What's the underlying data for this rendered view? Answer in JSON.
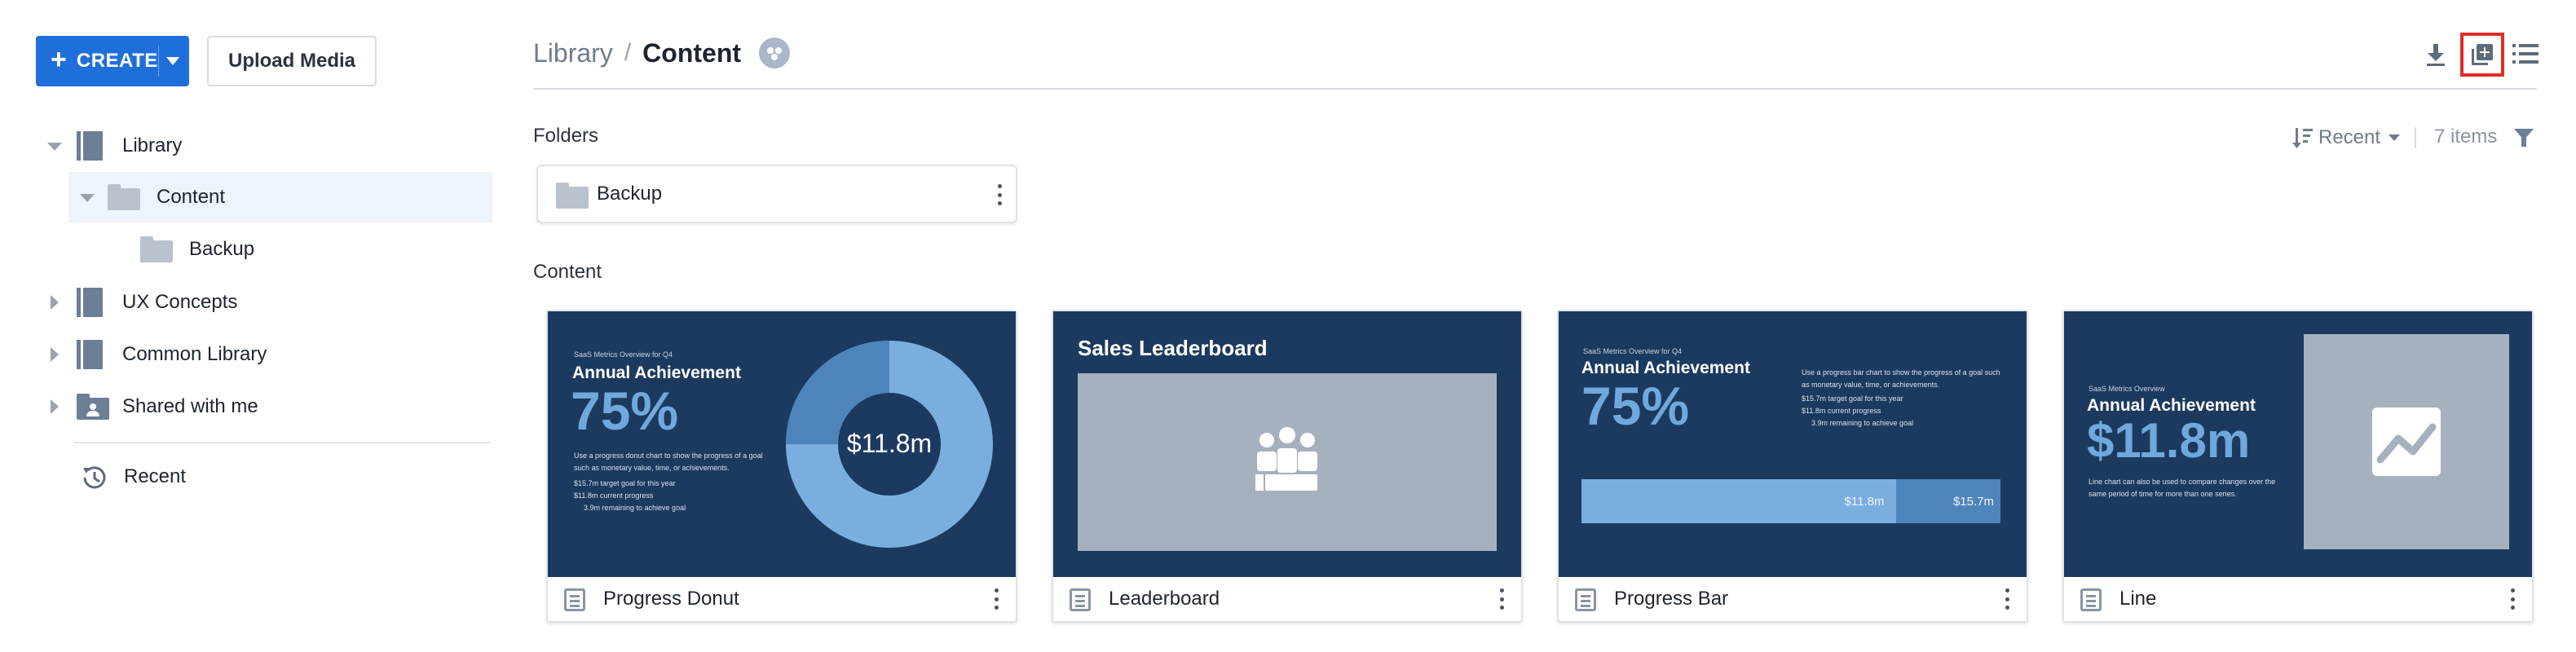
{
  "toolbar": {
    "create_label": "CREATE",
    "create_plus": "+",
    "upload_label": "Upload Media"
  },
  "sidebar": {
    "items": [
      {
        "label": "Library",
        "icon": "book-icon",
        "expanded": true
      },
      {
        "label": "Content",
        "icon": "folder-icon",
        "expanded": true,
        "selected": true
      },
      {
        "label": "Backup",
        "icon": "folder-icon"
      },
      {
        "label": "UX Concepts",
        "icon": "book-icon",
        "expanded": false
      },
      {
        "label": "Common Library",
        "icon": "book-icon",
        "expanded": false
      },
      {
        "label": "Shared with me",
        "icon": "shared-folder-icon",
        "expanded": false
      }
    ],
    "recent_label": "Recent"
  },
  "breadcrumb": {
    "root": "Library",
    "separator": "/",
    "current": "Content"
  },
  "header_tools": {
    "download": "download-icon",
    "add_view": "add-view-icon",
    "list_view": "list-view-icon",
    "highlight_color": "#e22d26"
  },
  "folders_section": {
    "label": "Folders",
    "sort_label": "Recent",
    "items_count": "7 items",
    "folders": [
      {
        "label": "Backup"
      }
    ]
  },
  "content_section": {
    "label": "Content",
    "cards": [
      {
        "title": "Progress Donut",
        "thumb": {
          "kicker": "SaaS Metrics Overview for Q4",
          "heading": "Annual Achievement",
          "big": "75%",
          "desc": "Use a progress donut chart to show the progress of a goal such as monetary value, time, or achievements.",
          "legend": [
            "$15.7m  target goal for this year",
            "$11.8m  current progress",
            "3.9m  remaining to achieve goal"
          ],
          "donut_label": "$11.8m",
          "donut_progress": 0.75
        }
      },
      {
        "title": "Leaderboard",
        "thumb": {
          "heading": "Sales Leaderboard"
        }
      },
      {
        "title": "Progress Bar",
        "thumb": {
          "kicker": "SaaS Metrics Overview for Q4",
          "heading": "Annual Achievement",
          "big": "75%",
          "desc": "Use a progress bar chart to show the progress of a goal such as monetary value, time, or achievements.",
          "legend": [
            "$15.7m  target goal for this year",
            "$11.8m  current progress",
            "3.9m  remaining to achieve goal"
          ],
          "bar_current": "$11.8m",
          "bar_target": "$15.7m",
          "bar_progress": 0.75
        }
      },
      {
        "title": "Line",
        "thumb": {
          "kicker": "SaaS Metrics Overview",
          "heading": "Annual Achievement",
          "big": "$11.8m",
          "desc": "Line chart can also be used to compare changes over the same period of time for more than one series."
        }
      }
    ]
  },
  "colors": {
    "brand": "#1f6fdb",
    "thumb_bg": "#1c3a5f",
    "thumb_accent": "#6fa8dc",
    "selected_row": "#eef4fb"
  }
}
